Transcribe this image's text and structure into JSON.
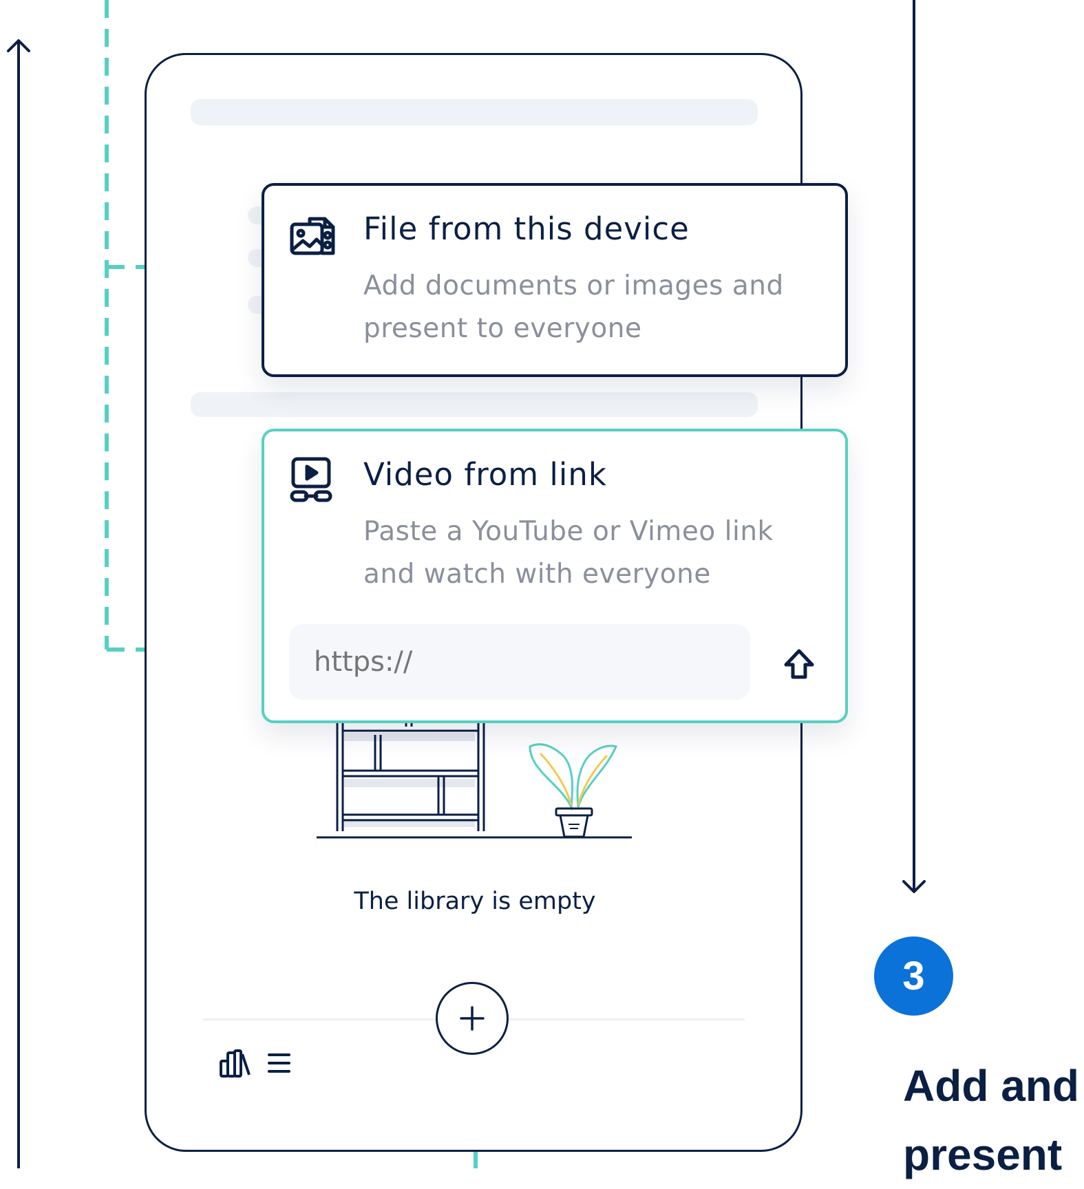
{
  "file_option": {
    "title": "File from this device",
    "description": "Add documents or images and present to everyone",
    "icon": "file-image-icon"
  },
  "video_option": {
    "title": "Video from link",
    "description": "Paste a YouTube or Vimeo link and watch with everyone",
    "icon": "video-link-icon",
    "url_placeholder": "https://",
    "submit_icon": "upload-arrow-icon"
  },
  "library": {
    "empty_message": "The library is empty"
  },
  "step": {
    "number": "3",
    "title": "Add and\npresent"
  },
  "colors": {
    "navy": "#0b1f44",
    "teal": "#56d0c4",
    "blue": "#0a72d8",
    "muted": "#8a8f9c"
  }
}
